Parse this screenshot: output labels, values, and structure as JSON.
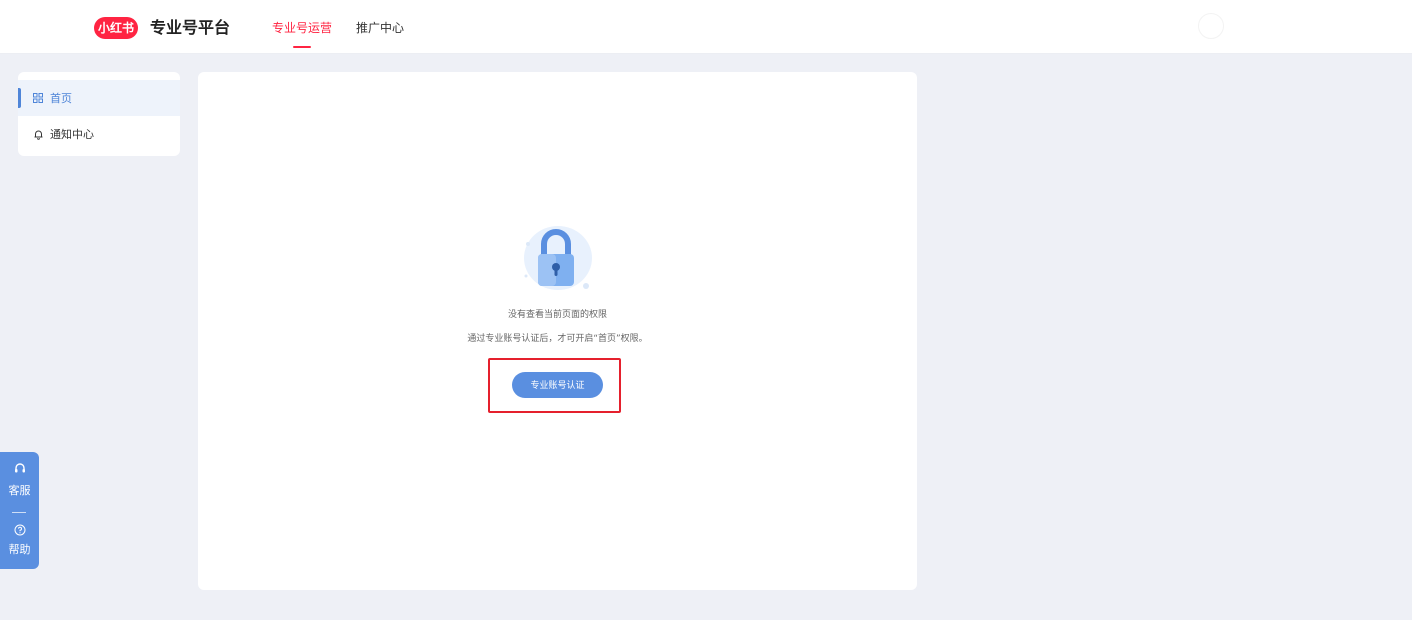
{
  "header": {
    "logo_text": "小红书",
    "platform_name": "专业号平台",
    "tabs": [
      {
        "label": "专业号运营",
        "active": true
      },
      {
        "label": "推广中心",
        "active": false
      }
    ]
  },
  "sidebar": {
    "items": [
      {
        "label": "首页",
        "icon": "grid-icon",
        "active": true
      },
      {
        "label": "通知中心",
        "icon": "bell-icon",
        "active": false
      }
    ]
  },
  "main": {
    "icon": "lock-icon",
    "message_title": "没有查看当前页面的权限",
    "message_detail": "通过专业账号认证后，才可开启“首页”权限。",
    "verify_button_label": "专业账号认证"
  },
  "floating_panel": {
    "service_label": "客服",
    "help_label": "帮助"
  },
  "colors": {
    "brand": "#ff2442",
    "accent": "#5a8fe0",
    "highlight": "#e5202d",
    "background": "#eef0f6"
  }
}
